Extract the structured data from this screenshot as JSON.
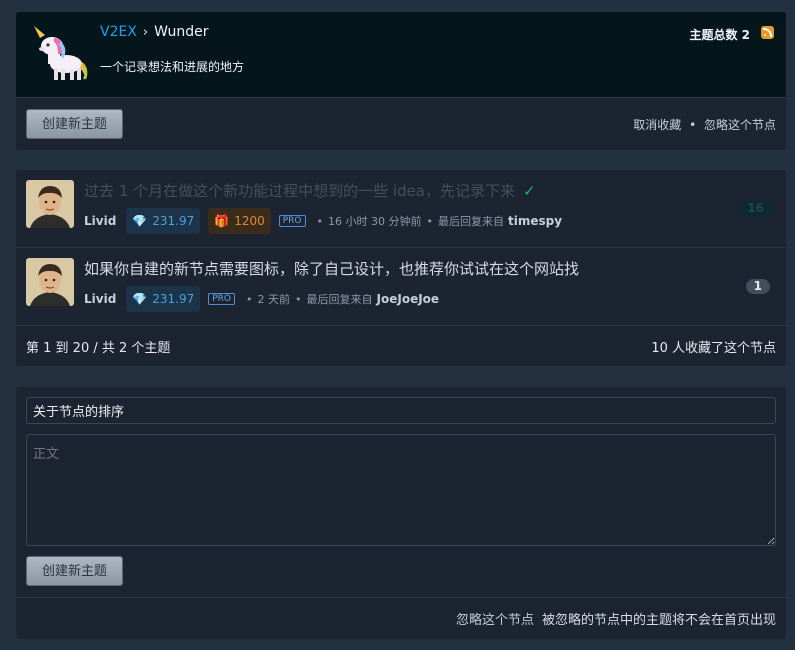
{
  "header": {
    "site": "V2EX",
    "separator": "›",
    "node": "Wunder",
    "description": "一个记录想法和进展的地方",
    "topic_count_label": "主题总数",
    "topic_count": "2",
    "rss_icon": "rss-icon"
  },
  "node_actions": {
    "create_label": "创建新主题",
    "unfavorite": "取消收藏",
    "dot": "•",
    "ignore": "忽略这个节点"
  },
  "topics": [
    {
      "title": "过去 1 个月在做这个新功能过程中想到的一些 idea，先记录下来",
      "check": "✓",
      "author": "Livid",
      "gems": "231.97",
      "gifts": "1200",
      "pro": "PRO",
      "time": "16 小时 30 分钟前",
      "last_reply_label": "最后回复来自",
      "last_reply_user": "timespy",
      "replies": "16"
    },
    {
      "title": "如果你自建的新节点需要图标，除了自己设计，也推荐你试试在这个网站找",
      "author": "Livid",
      "gems": "231.97",
      "pro": "PRO",
      "time": "2 天前",
      "last_reply_label": "最后回复来自",
      "last_reply_user": "JoeJoeJoe",
      "replies": "1"
    }
  ],
  "bullet": "•",
  "topics_footer": {
    "range": "第 1 到 20 / 共 2 个主题",
    "favorites": "10 人收藏了这个节点"
  },
  "new_topic": {
    "title_value": "关于节点的排序",
    "body_placeholder": "正文",
    "create_label": "创建新主题",
    "ignore_link": "忽略这个节点",
    "ignore_note": "被忽略的节点中的主题将不会在首页出现"
  },
  "colors": {
    "page_bg": "#22303f",
    "box_bg": "#1c2431",
    "header_bg": "#04151c",
    "link_blue": "#1ea1e8",
    "check_green": "#21b65e"
  }
}
